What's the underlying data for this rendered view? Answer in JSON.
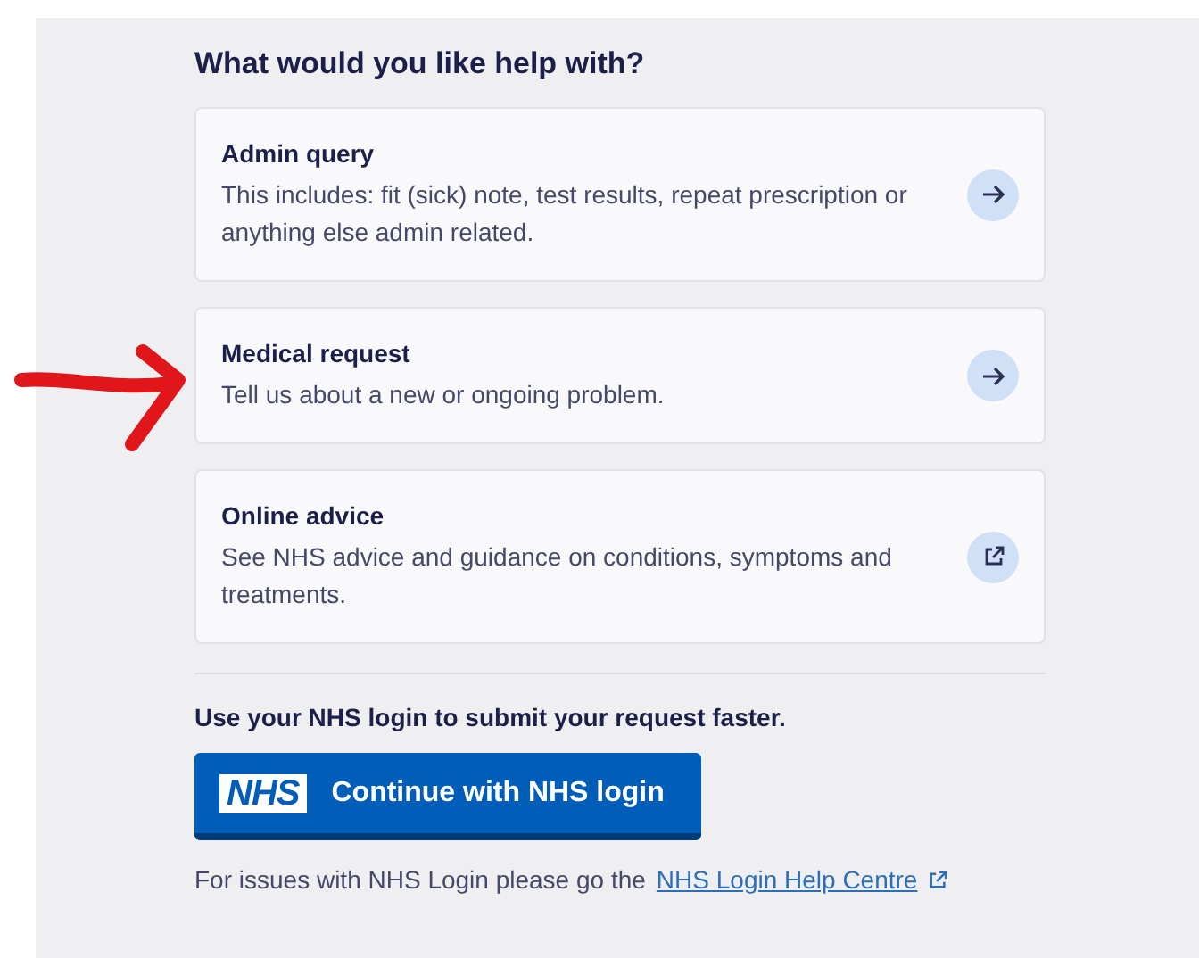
{
  "heading": "What would you like help with?",
  "options": [
    {
      "title": "Admin query",
      "description": "This includes: fit (sick) note, test results, repeat prescription or anything else admin related.",
      "kind": "arrow"
    },
    {
      "title": "Medical request",
      "description": "Tell us about a new or ongoing problem.",
      "kind": "arrow"
    },
    {
      "title": "Online advice",
      "description": "See NHS advice and guidance on conditions, symptoms and treatments.",
      "kind": "external"
    }
  ],
  "login": {
    "prompt": "Use your NHS login to submit your request faster.",
    "logo": "NHS",
    "button": "Continue with NHS login",
    "help_text": "For issues with NHS Login please go the",
    "help_link": "NHS Login Help Centre"
  }
}
